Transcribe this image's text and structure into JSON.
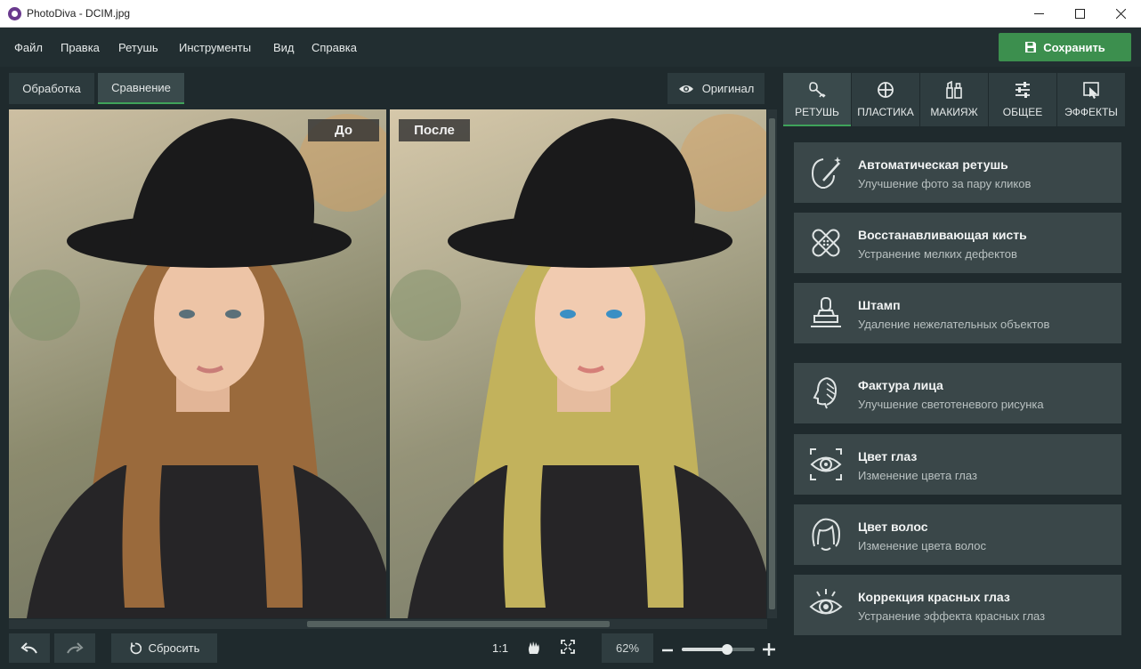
{
  "window": {
    "title": "PhotoDiva - DCIM.jpg"
  },
  "menu": [
    "Файл",
    "Правка",
    "Ретушь",
    "Инструменты",
    "Вид",
    "Справка"
  ],
  "toolbar": {
    "save_label": "Сохранить"
  },
  "view_tabs": [
    "Обработка",
    "Сравнение"
  ],
  "original_label": "Оригинал",
  "compare": {
    "before_label": "До",
    "after_label": "После"
  },
  "bottom": {
    "reset_label": "Сбросить",
    "ratio_label": "1:1",
    "zoom_value": "62%",
    "zoom_fraction": 0.62
  },
  "panel_tabs": [
    "РЕТУШЬ",
    "ПЛАСТИКА",
    "МАКИЯЖ",
    "ОБЩЕЕ",
    "ЭФФЕКТЫ"
  ],
  "tools": [
    {
      "title": "Автоматическая ретушь",
      "desc": "Улучшение фото за пару кликов",
      "icon": "magic-face-icon"
    },
    {
      "title": "Восстанавливающая кисть",
      "desc": "Устранение мелких дефектов",
      "icon": "bandage-icon"
    },
    {
      "title": "Штамп",
      "desc": "Удаление нежелательных объектов",
      "icon": "stamp-icon"
    },
    {
      "title": "Фактура лица",
      "desc": "Улучшение светотеневого рисунка",
      "icon": "face-texture-icon"
    },
    {
      "title": "Цвет глаз",
      "desc": "Изменение цвета глаз",
      "icon": "eye-target-icon"
    },
    {
      "title": "Цвет волос",
      "desc": "Изменение цвета волос",
      "icon": "hair-icon"
    },
    {
      "title": "Коррекция красных глаз",
      "desc": "Устранение эффекта красных глаз",
      "icon": "red-eye-icon"
    }
  ],
  "colors": {
    "accent": "#3fa35a",
    "save": "#3c8f4e",
    "panel": "#3a4749",
    "hair_before": "#9a6a3c",
    "hair_after": "#c2b25c"
  }
}
